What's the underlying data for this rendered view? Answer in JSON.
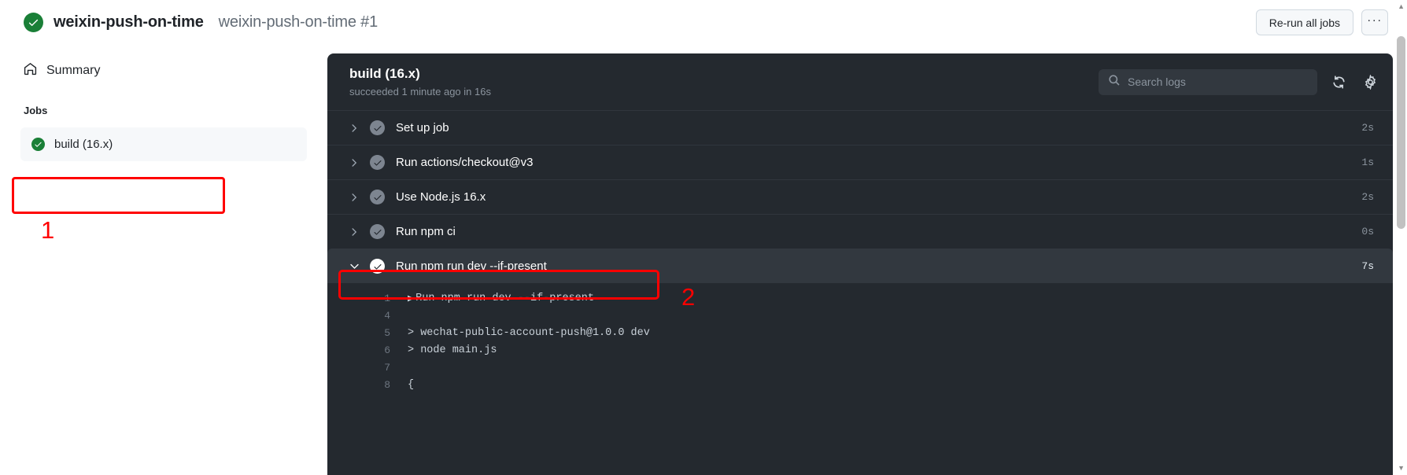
{
  "topbar": {
    "status_icon": "check-circle-icon",
    "run_title": "weixin-push-on-time",
    "run_subtitle": "weixin-push-on-time #1",
    "rerun_label": "Re-run all jobs",
    "kebab_label": "···"
  },
  "sidebar": {
    "summary_label": "Summary",
    "summary_icon": "home-icon",
    "jobs_header": "Jobs",
    "jobs": [
      {
        "label": "build (16.x)",
        "status_icon": "check-circle-icon"
      }
    ]
  },
  "annotations": [
    {
      "number": "1",
      "target": "sidebar-job-build"
    },
    {
      "number": "2",
      "target": "step-run-npm-run-dev"
    }
  ],
  "log_panel": {
    "job_title": "build (16.x)",
    "job_status": "succeeded 1 minute ago in 16s",
    "search": {
      "placeholder": "Search logs",
      "value": "",
      "icon": "search-icon"
    },
    "refresh_icon": "refresh-icon",
    "settings_icon": "gear-icon",
    "steps": [
      {
        "label": "Set up job",
        "duration": "2s",
        "expanded": false,
        "chevron": "chevron-right-icon"
      },
      {
        "label": "Run actions/checkout@v3",
        "duration": "1s",
        "expanded": false,
        "chevron": "chevron-right-icon"
      },
      {
        "label": "Use Node.js 16.x",
        "duration": "2s",
        "expanded": false,
        "chevron": "chevron-right-icon"
      },
      {
        "label": "Run npm ci",
        "duration": "0s",
        "expanded": false,
        "chevron": "chevron-right-icon"
      },
      {
        "label": "Run npm run dev --if-present",
        "duration": "7s",
        "expanded": true,
        "chevron": "chevron-down-icon"
      }
    ],
    "log_lines": [
      {
        "number": "1",
        "text": "Run npm run dev --if-present",
        "caret": true
      },
      {
        "number": "4",
        "text": "",
        "caret": false
      },
      {
        "number": "5",
        "text": "> wechat-public-account-push@1.0.0 dev",
        "caret": false
      },
      {
        "number": "6",
        "text": "> node main.js",
        "caret": false
      },
      {
        "number": "7",
        "text": "",
        "caret": false
      },
      {
        "number": "8",
        "text": "{",
        "caret": false
      }
    ]
  },
  "colors": {
    "success_green": "#1a7f37",
    "panel_bg": "#24292f",
    "panel_row_expanded": "#32383f",
    "annotation_red": "#ff0000",
    "text_muted": "#8b949e"
  }
}
